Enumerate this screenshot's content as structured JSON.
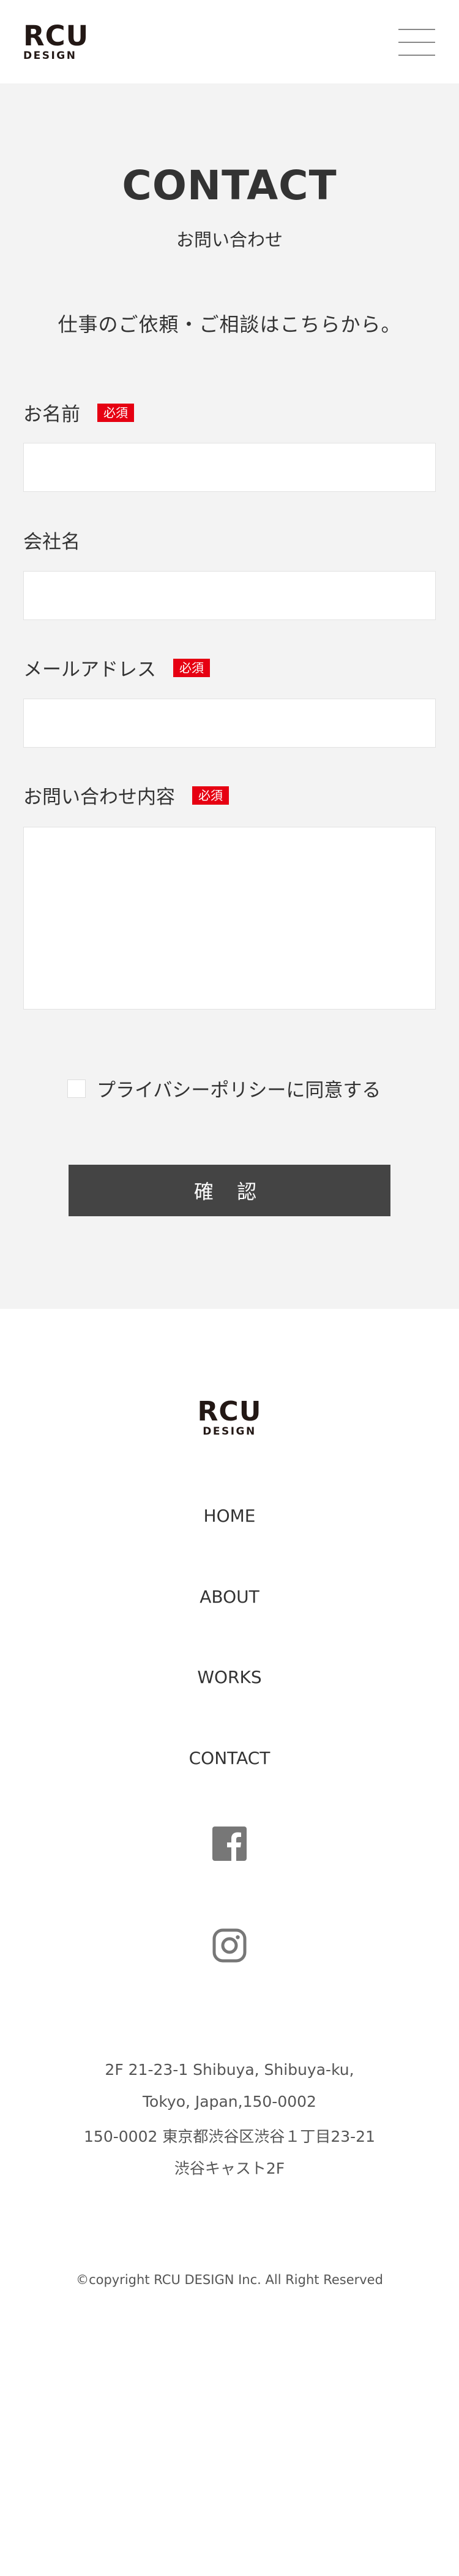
{
  "header": {
    "logo_top": "RCU",
    "logo_bottom": "DESIGN",
    "menu_icon": "hamburger-menu-icon"
  },
  "contact": {
    "title": "CONTACT",
    "subtitle": "お問い合わせ",
    "lead": "仕事のご依頼・ご相談はこちらから。",
    "required_label": "必須",
    "fields": [
      {
        "label": "お名前",
        "required": true,
        "value": ""
      },
      {
        "label": "会社名",
        "required": false,
        "value": ""
      },
      {
        "label": "メールアドレス",
        "required": true,
        "value": ""
      },
      {
        "label": "お問い合わせ内容",
        "required": true,
        "value": ""
      }
    ],
    "privacy_label": "プライバシーポリシーに同意する",
    "privacy_checked": false,
    "confirm_label": "確 認"
  },
  "footer": {
    "logo_top": "RCU",
    "logo_bottom": "DESIGN",
    "nav": [
      "HOME",
      "ABOUT",
      "WORKS",
      "CONTACT"
    ],
    "social": [
      "facebook-icon",
      "instagram-icon"
    ],
    "address": [
      "2F 21-23-1 Shibuya, Shibuya-ku,",
      "Tokyo, Japan,150-0002",
      "150-0002 東京都渋谷区渋谷１丁目23-21",
      "渋谷キャスト2F"
    ],
    "copyright": "©copyright RCU DESIGN Inc. All Right Reserved"
  },
  "colors": {
    "section_bg": "#f3f3f3",
    "required_badge": "#e60012",
    "button_bg": "#444444",
    "logo": "#231815"
  }
}
